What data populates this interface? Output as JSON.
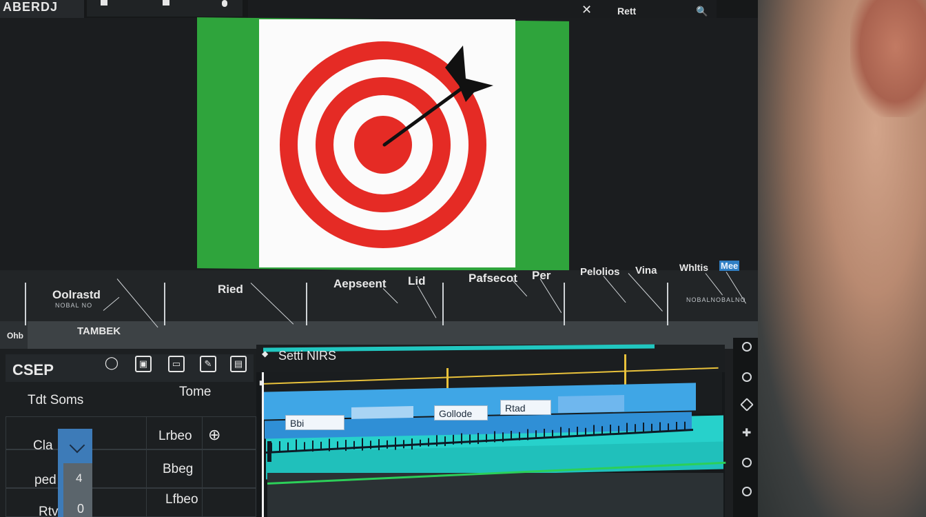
{
  "window": {
    "title": "ABERDJ",
    "top_icons": {
      "close": "✕",
      "text": "Rett",
      "search": "🔍"
    }
  },
  "preview": {
    "frame_colors": {
      "green": "#2fa43c",
      "target_red": "#e52b25",
      "target_white": "#fbfbfb",
      "dart": "#111111"
    }
  },
  "labels_band": {
    "items": [
      {
        "label": "Oolrastd",
        "sub": "NOBAL NO"
      },
      {
        "label": "TAMBEK",
        "sub": ""
      },
      {
        "label": "Ried",
        "sub": ""
      },
      {
        "label": "Aepseent",
        "sub": ""
      },
      {
        "label": "Lid",
        "sub": ""
      },
      {
        "label": "Pafsecot",
        "sub": ""
      },
      {
        "label": "Per",
        "sub": ""
      },
      {
        "label": "Pelolios",
        "sub": ""
      },
      {
        "label": "Vina",
        "sub": ""
      },
      {
        "label": "Whltis",
        "sub": "NOBALNOBALNO"
      },
      {
        "label": "Mee",
        "sub": ""
      }
    ],
    "left_edge": "Ohb"
  },
  "left_panel": {
    "title": "CSEP",
    "tools": [
      "◯",
      "▣",
      "▭",
      "✎",
      "▤"
    ],
    "columns": [
      "Tdt Soms",
      "Tome"
    ],
    "rows": [
      {
        "name": "Cla",
        "value": "",
        "right": "Lrbeo",
        "icon": "⊕"
      },
      {
        "name": "ped",
        "value": "4",
        "right": "Bbeg",
        "icon": ""
      },
      {
        "name": "Rtv",
        "value": "0",
        "right": "Lfbeo",
        "icon": ""
      }
    ]
  },
  "timeline": {
    "header": "Setti NIRS",
    "clips": [
      {
        "label": "Bbi"
      },
      {
        "label": "Gollode"
      },
      {
        "label": "Rtad"
      }
    ]
  },
  "side_tools": [
    "⊙",
    "⊙",
    "◇",
    "✚",
    "⊙",
    "⊙"
  ]
}
